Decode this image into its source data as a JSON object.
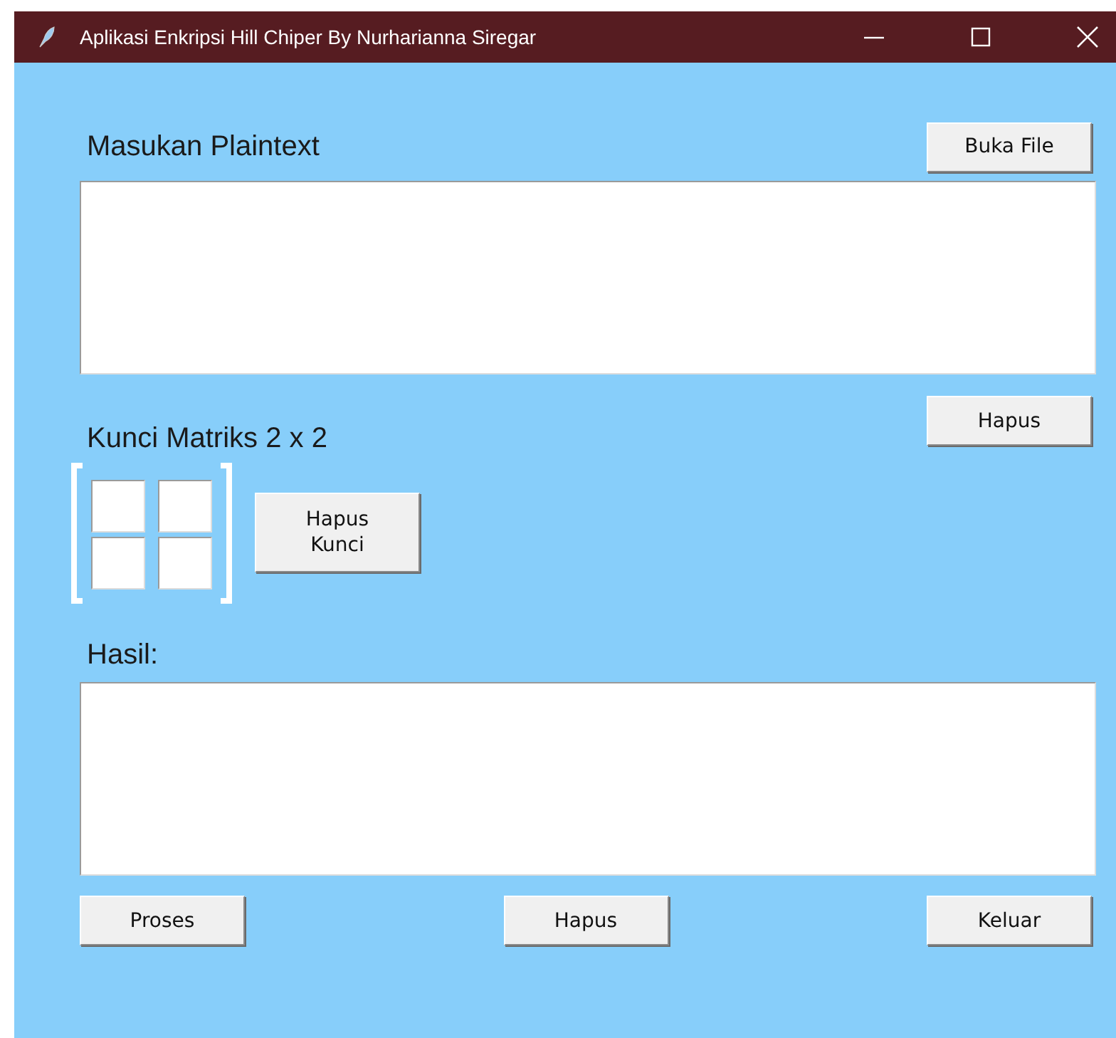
{
  "window": {
    "title": "Aplikasi Enkripsi Hill Chiper By Nurharianna Siregar"
  },
  "plaintext": {
    "label": "Masukan Plaintext",
    "open_button": "Buka File",
    "clear_button": "Hapus"
  },
  "key": {
    "label": "Kunci Matriks 2 x 2",
    "clear_button": "Hapus Kunci"
  },
  "result": {
    "label": "Hasil:"
  },
  "buttons": [
    "Proses",
    "Hapus",
    "Keluar"
  ]
}
